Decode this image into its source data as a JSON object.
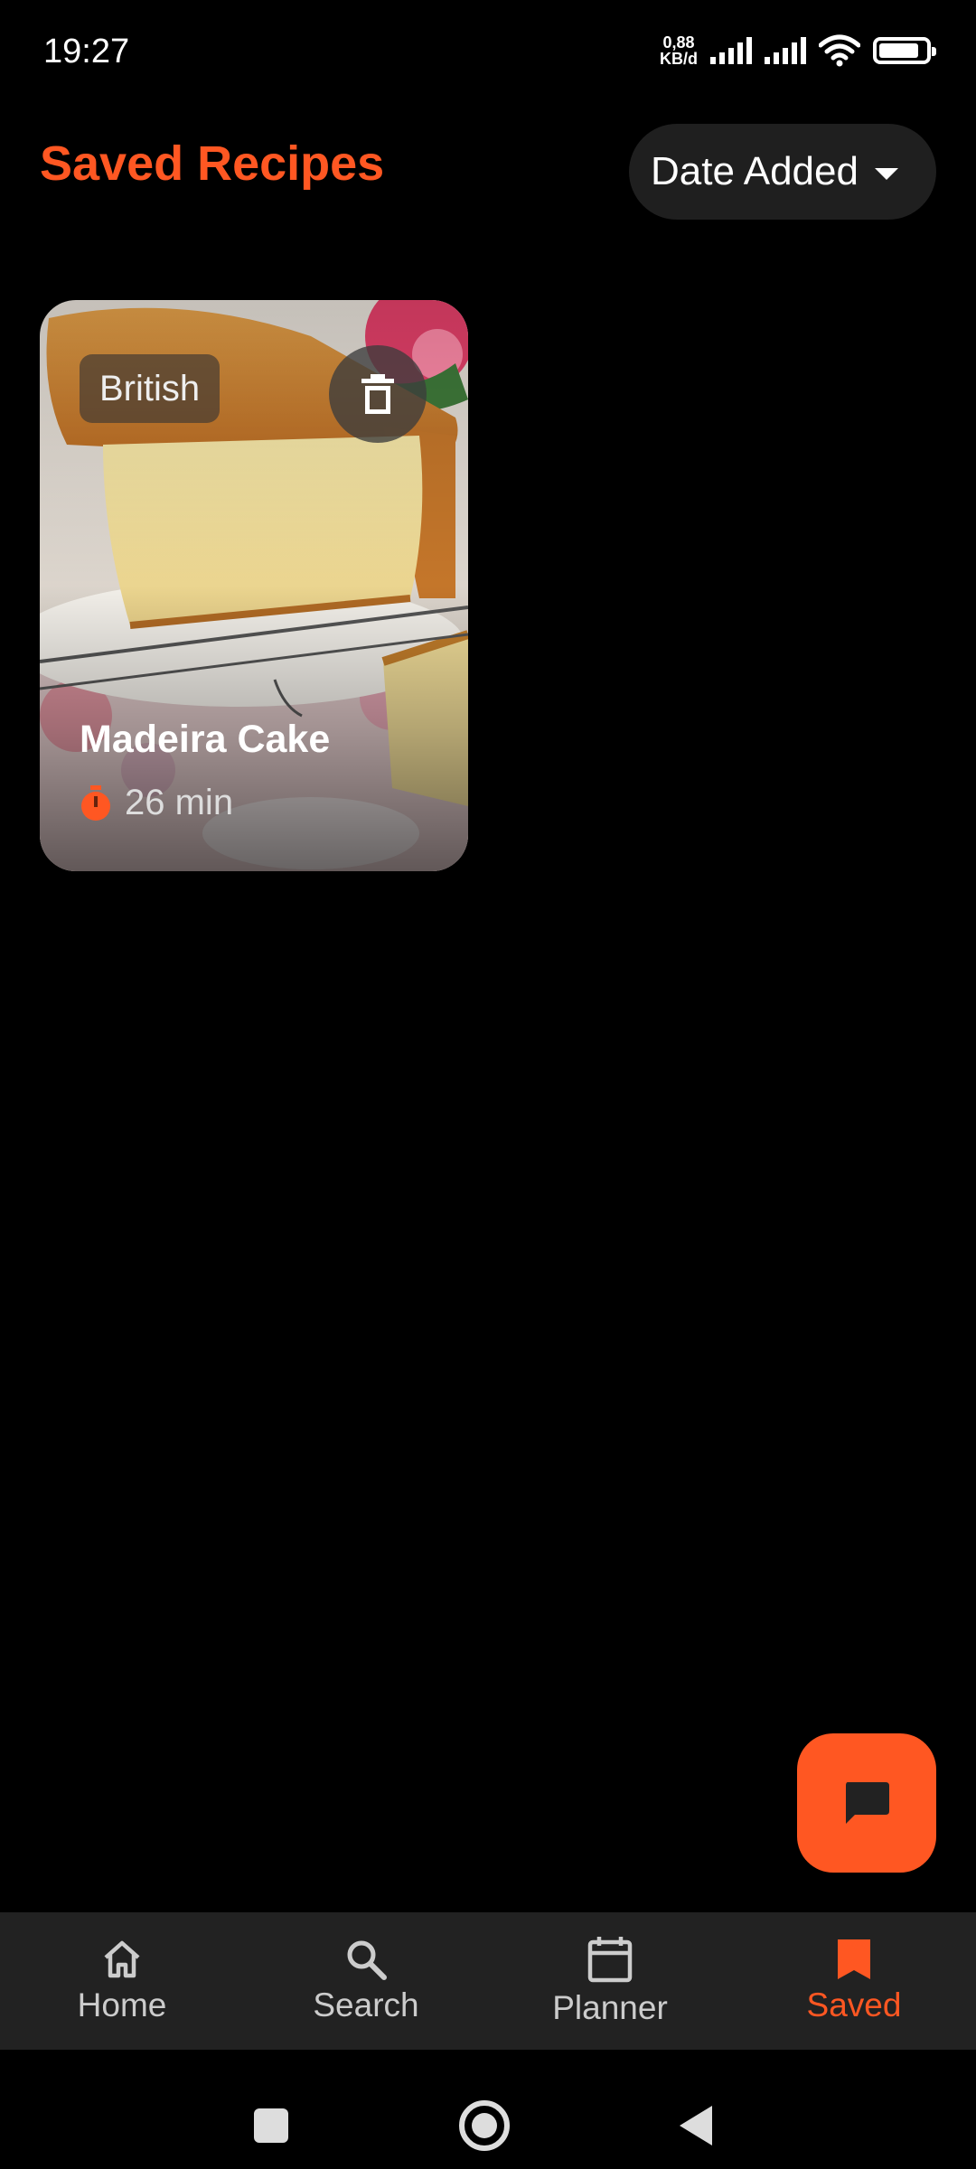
{
  "status_bar": {
    "time": "19:27",
    "net_speed_value": "0,88",
    "net_speed_unit": "KB/d",
    "battery_level": 0.85
  },
  "header": {
    "title": "Saved Recipes",
    "sort_label": "Date Added"
  },
  "recipes": [
    {
      "cuisine": "British",
      "title": "Madeira Cake",
      "time": "26 min"
    }
  ],
  "bottom_nav": {
    "items": [
      {
        "label": "Home",
        "icon": "home-icon"
      },
      {
        "label": "Search",
        "icon": "search-icon"
      },
      {
        "label": "Planner",
        "icon": "calendar-icon"
      },
      {
        "label": "Saved",
        "icon": "bookmark-icon",
        "active": true
      }
    ]
  },
  "colors": {
    "accent": "#FF5722",
    "background": "#000000",
    "nav_background": "#222222"
  }
}
